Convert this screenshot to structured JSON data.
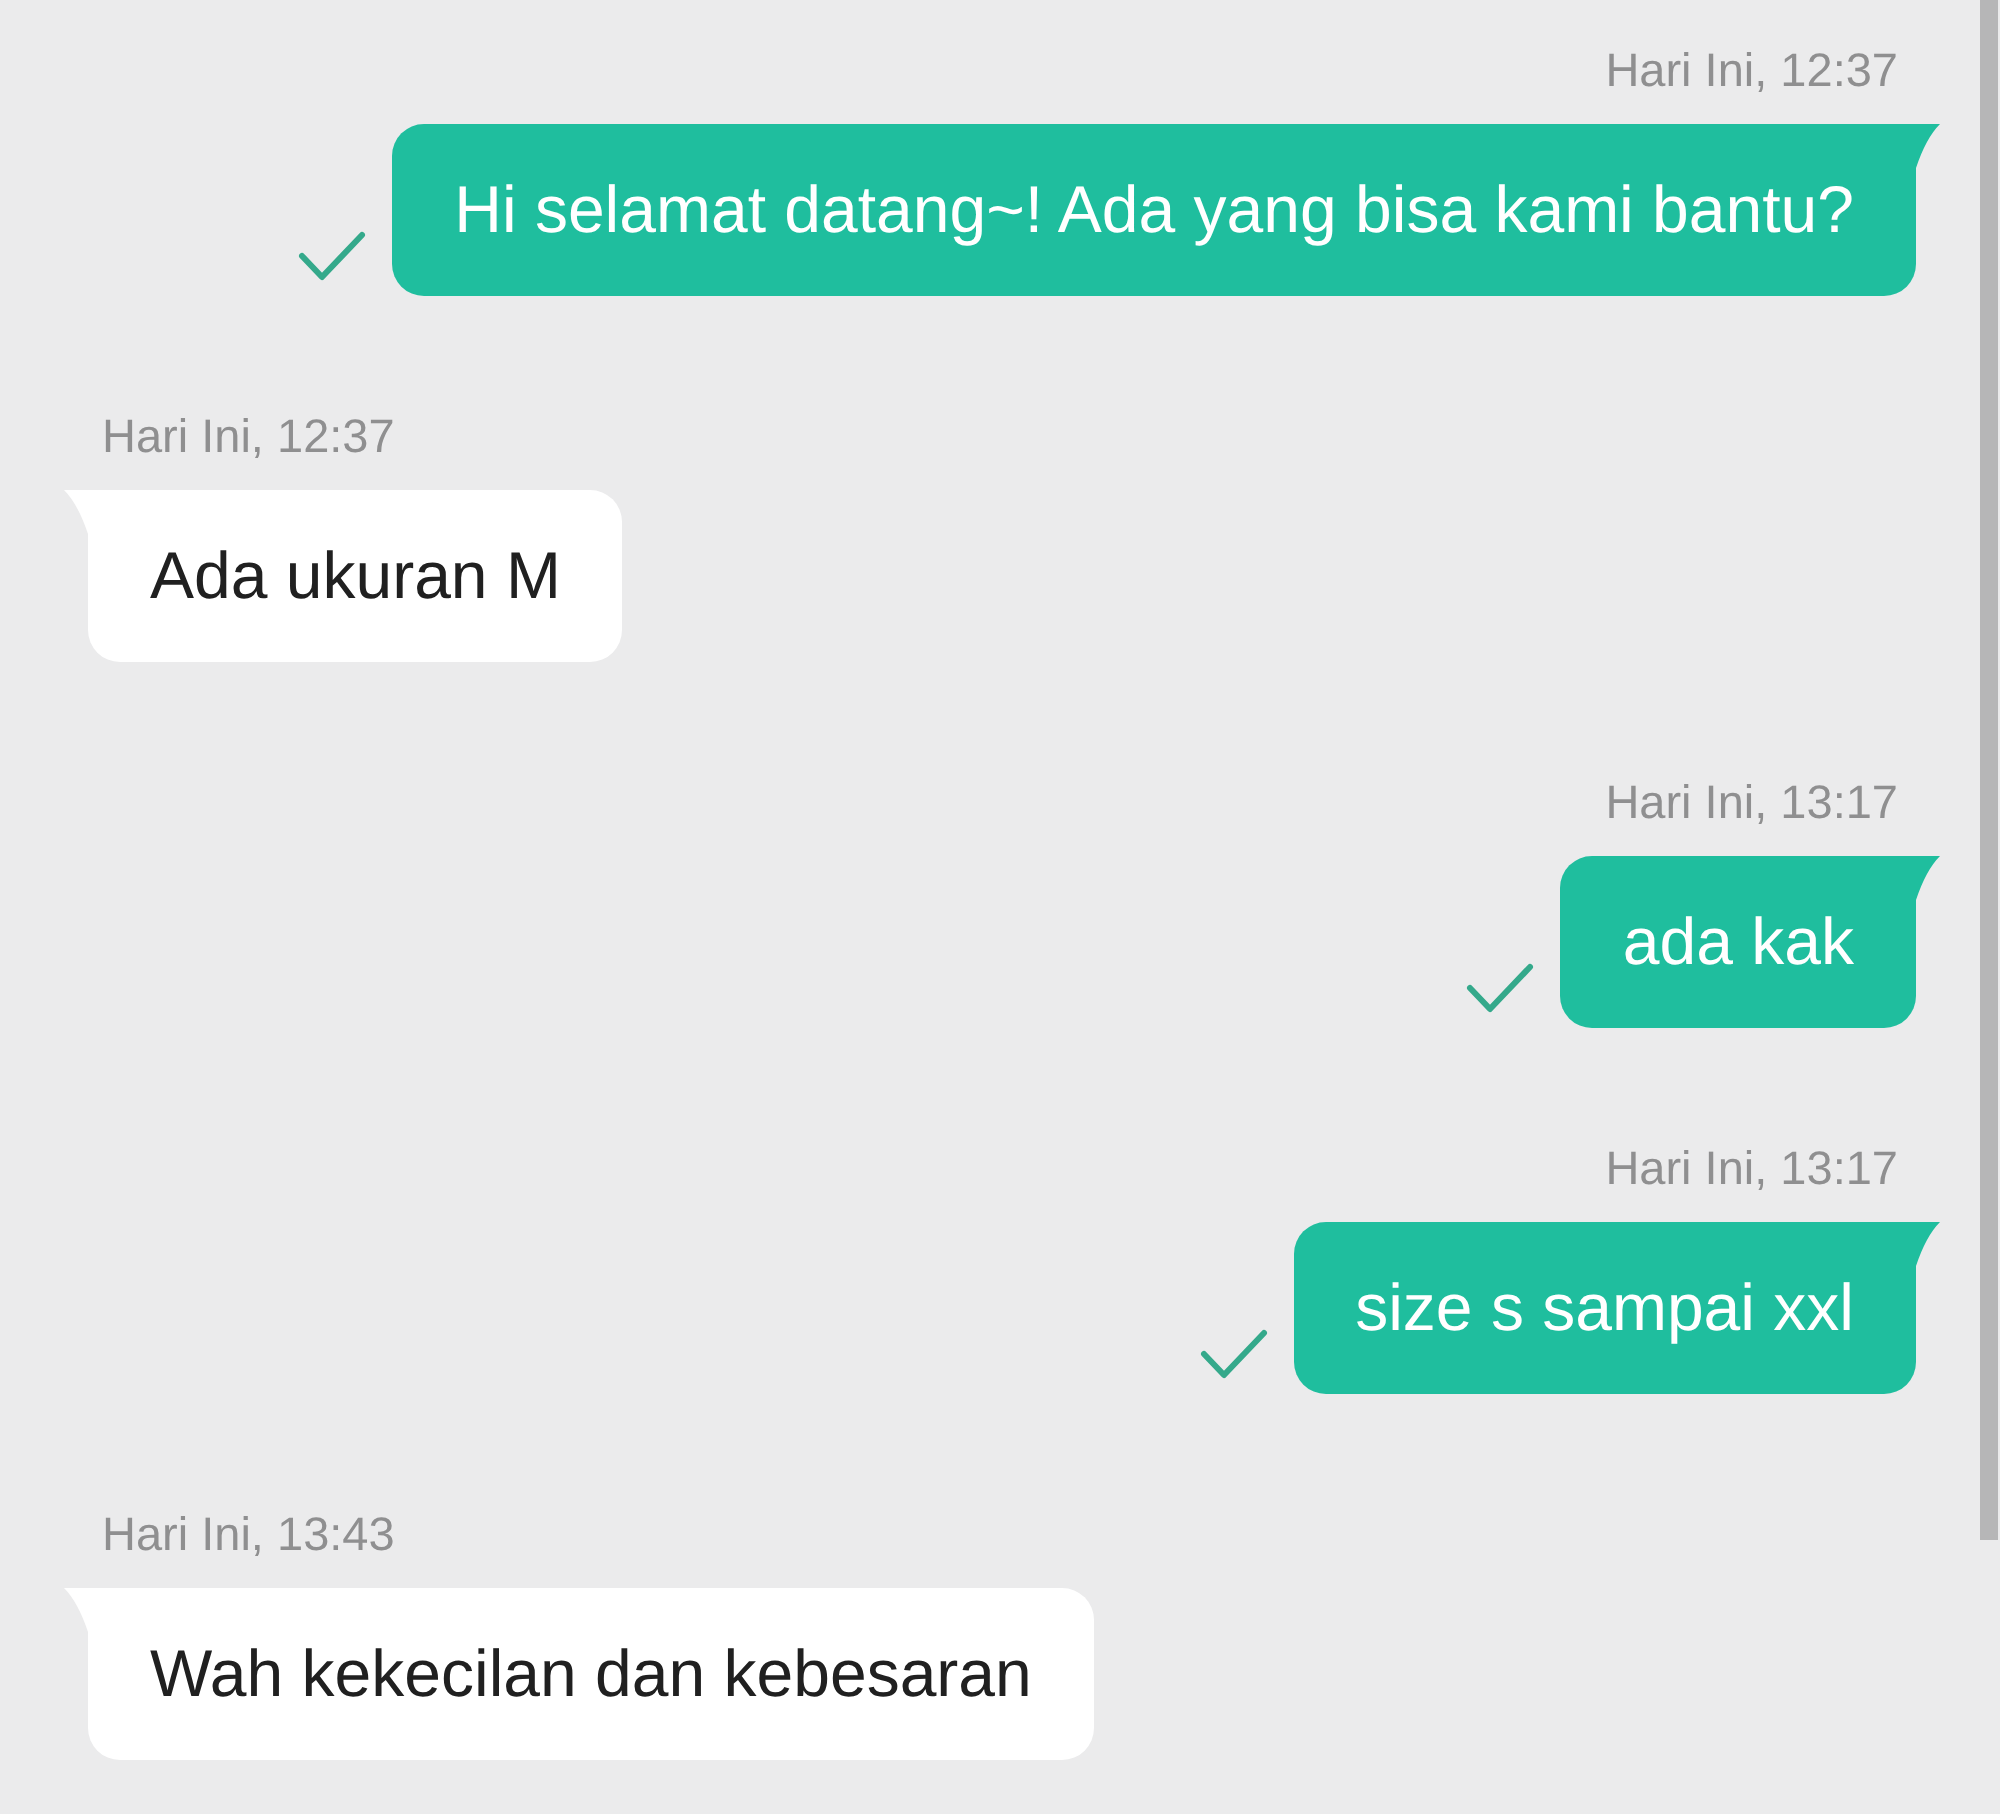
{
  "messages": [
    {
      "kind": "outgoing",
      "time": "Hari Ini, 12:37",
      "text": "Hi selamat datang~! Ada yang bisa kami bantu?",
      "delivered": true
    },
    {
      "kind": "incoming",
      "time": "Hari Ini, 12:37",
      "text": "Ada ukuran M"
    },
    {
      "kind": "outgoing",
      "time": "Hari Ini, 13:17",
      "text": "ada kak",
      "delivered": true
    },
    {
      "kind": "outgoing",
      "time": "Hari Ini, 13:17",
      "text": "size s sampai xxl",
      "delivered": true
    },
    {
      "kind": "incoming",
      "time": "Hari Ini, 13:43",
      "text": "Wah kekecilan dan kebesaran"
    }
  ]
}
